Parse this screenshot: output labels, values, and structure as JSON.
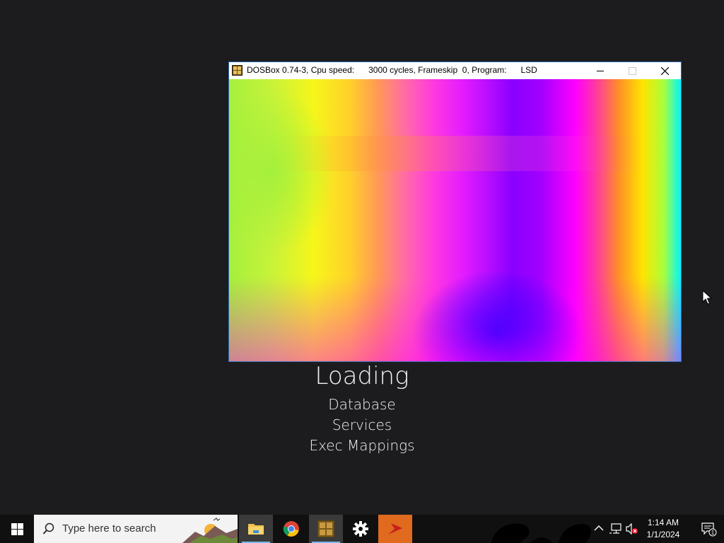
{
  "window": {
    "title": "DOSBox 0.74-3, Cpu speed:      3000 cycles, Frameskip  0, Program:      LSD"
  },
  "loading": {
    "title": "Loading",
    "items": [
      "Database",
      "Services",
      "Exec Mappings"
    ]
  },
  "taskbar": {
    "search_placeholder": "Type here to search",
    "apps": [
      "file-explorer",
      "chrome",
      "dosbox",
      "settings",
      "app-orange"
    ],
    "clock": {
      "time": "1:14 AM",
      "date": "1/1/2024"
    },
    "notification_count": "1"
  },
  "colors": {
    "desktop": "#1c1c1e",
    "taskbar": "#101010",
    "accent": "#76b9ed"
  }
}
